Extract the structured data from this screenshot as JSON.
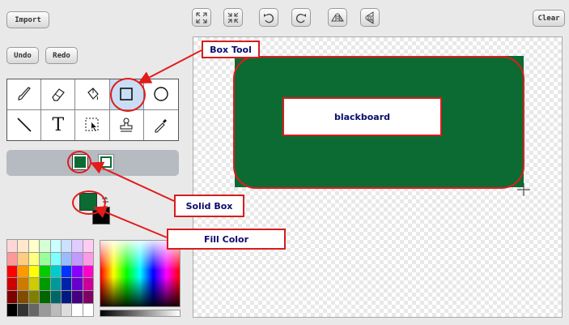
{
  "toolbar": {
    "import_label": "Import",
    "undo_label": "Undo",
    "redo_label": "Redo",
    "clear_label": "Clear",
    "canvas_actions": [
      "grow-icon",
      "shrink-icon",
      "rotate-left-icon",
      "rotate-right-icon",
      "flip-horizontal-icon",
      "flip-vertical-icon"
    ]
  },
  "tools": [
    {
      "name": "brush",
      "icon": "paintbrush-icon"
    },
    {
      "name": "eraser",
      "icon": "eraser-icon"
    },
    {
      "name": "fill",
      "icon": "paint-bucket-icon"
    },
    {
      "name": "rectangle",
      "icon": "rectangle-icon",
      "selected": true
    },
    {
      "name": "ellipse",
      "icon": "ellipse-icon"
    },
    {
      "name": "line",
      "icon": "line-icon"
    },
    {
      "name": "text",
      "icon": "text-icon"
    },
    {
      "name": "select",
      "icon": "select-icon"
    },
    {
      "name": "stamp",
      "icon": "stamp-icon"
    },
    {
      "name": "eyedropper",
      "icon": "eyedropper-icon"
    }
  ],
  "fill_modes": [
    "solid-box-icon",
    "outline-box-icon"
  ],
  "colors": {
    "foreground": "#0b6b32",
    "background": "#000000",
    "annotation_red": "#e21b1b",
    "label_text": "#0b0b6e"
  },
  "canvas": {
    "blackboard_label": "blackboard"
  },
  "annotations": {
    "box_tool": "Box Tool",
    "solid_box": "Solid Box",
    "fill_color": "Fill Color"
  }
}
